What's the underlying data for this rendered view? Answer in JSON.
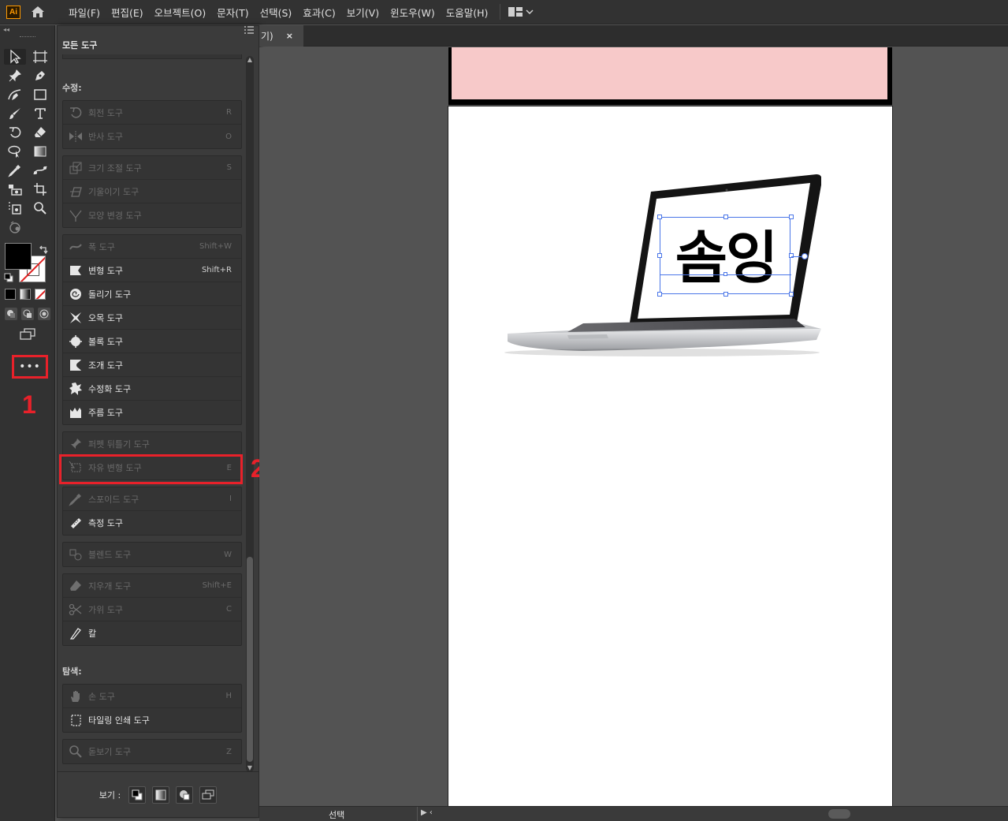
{
  "app": {
    "logo_text": "Ai"
  },
  "menu": [
    "파일(F)",
    "편집(E)",
    "오브젝트(O)",
    "문자(T)",
    "선택(S)",
    "효과(C)",
    "보기(V)",
    "윈도우(W)",
    "도움말(H)"
  ],
  "document": {
    "tab_label": "기)",
    "close_label": "×"
  },
  "toolbar": {
    "collapse_label": "◂◂",
    "more_label": "•••"
  },
  "annotations": {
    "one": "1",
    "two": "2"
  },
  "panel": {
    "title": "모든 도구",
    "section_modify": "수정:",
    "section_navigate": "탐색:",
    "footer_label": "보기 :",
    "groups": {
      "rotate": [
        {
          "name": "회전 도구",
          "shortcut": "R",
          "disabled": true,
          "icon": "rotate-icon"
        },
        {
          "name": "반사 도구",
          "shortcut": "O",
          "disabled": true,
          "icon": "reflect-icon"
        }
      ],
      "scale": [
        {
          "name": "크기 조절 도구",
          "shortcut": "S",
          "disabled": true,
          "icon": "scale-icon"
        },
        {
          "name": "기울이기 도구",
          "shortcut": "",
          "disabled": true,
          "icon": "shear-icon"
        },
        {
          "name": "모양 변경 도구",
          "shortcut": "",
          "disabled": true,
          "icon": "reshape-icon"
        }
      ],
      "width": [
        {
          "name": "폭 도구",
          "shortcut": "Shift+W",
          "disabled": true,
          "icon": "width-icon"
        },
        {
          "name": "변형 도구",
          "shortcut": "Shift+R",
          "disabled": false,
          "icon": "warp-icon"
        },
        {
          "name": "돌리기 도구",
          "shortcut": "",
          "disabled": false,
          "icon": "twirl-icon"
        },
        {
          "name": "오목 도구",
          "shortcut": "",
          "disabled": false,
          "icon": "pucker-icon"
        },
        {
          "name": "볼록 도구",
          "shortcut": "",
          "disabled": false,
          "icon": "bloat-icon"
        },
        {
          "name": "조개 도구",
          "shortcut": "",
          "disabled": false,
          "icon": "scallop-icon"
        },
        {
          "name": "수정화 도구",
          "shortcut": "",
          "disabled": false,
          "icon": "crystallize-icon"
        },
        {
          "name": "주름 도구",
          "shortcut": "",
          "disabled": false,
          "icon": "wrinkle-icon"
        }
      ],
      "puppet": [
        {
          "name": "퍼펫 뒤틀기 도구",
          "shortcut": "",
          "disabled": true,
          "icon": "puppet-warp-icon"
        },
        {
          "name": "자유 변형 도구",
          "shortcut": "E",
          "disabled": true,
          "icon": "free-transform-icon"
        }
      ],
      "eyedropper": [
        {
          "name": "스포이드 도구",
          "shortcut": "I",
          "disabled": true,
          "icon": "eyedropper-icon"
        },
        {
          "name": "측정 도구",
          "shortcut": "",
          "disabled": false,
          "icon": "measure-icon"
        }
      ],
      "blend": [
        {
          "name": "블렌드 도구",
          "shortcut": "W",
          "disabled": true,
          "icon": "blend-icon"
        }
      ],
      "eraser": [
        {
          "name": "지우개 도구",
          "shortcut": "Shift+E",
          "disabled": true,
          "icon": "eraser-icon"
        },
        {
          "name": "가위 도구",
          "shortcut": "C",
          "disabled": true,
          "icon": "scissors-icon"
        },
        {
          "name": "칼",
          "shortcut": "",
          "disabled": false,
          "icon": "knife-icon"
        }
      ],
      "hand": [
        {
          "name": "손 도구",
          "shortcut": "H",
          "disabled": true,
          "icon": "hand-icon"
        },
        {
          "name": "타일링 인쇄 도구",
          "shortcut": "",
          "disabled": false,
          "icon": "print-tiling-icon"
        }
      ],
      "zoom": [
        {
          "name": "돋보기 도구",
          "shortcut": "Z",
          "disabled": true,
          "icon": "zoom-icon"
        }
      ]
    }
  },
  "artwork": {
    "screen_text": "솜잉",
    "top_artboard_color": "#f7c9c9"
  },
  "status": {
    "selection_label": "선택"
  },
  "colors": {
    "accent_red": "#e8212a",
    "selection_blue": "#4a76e8",
    "ai_orange": "#ff9a00"
  }
}
